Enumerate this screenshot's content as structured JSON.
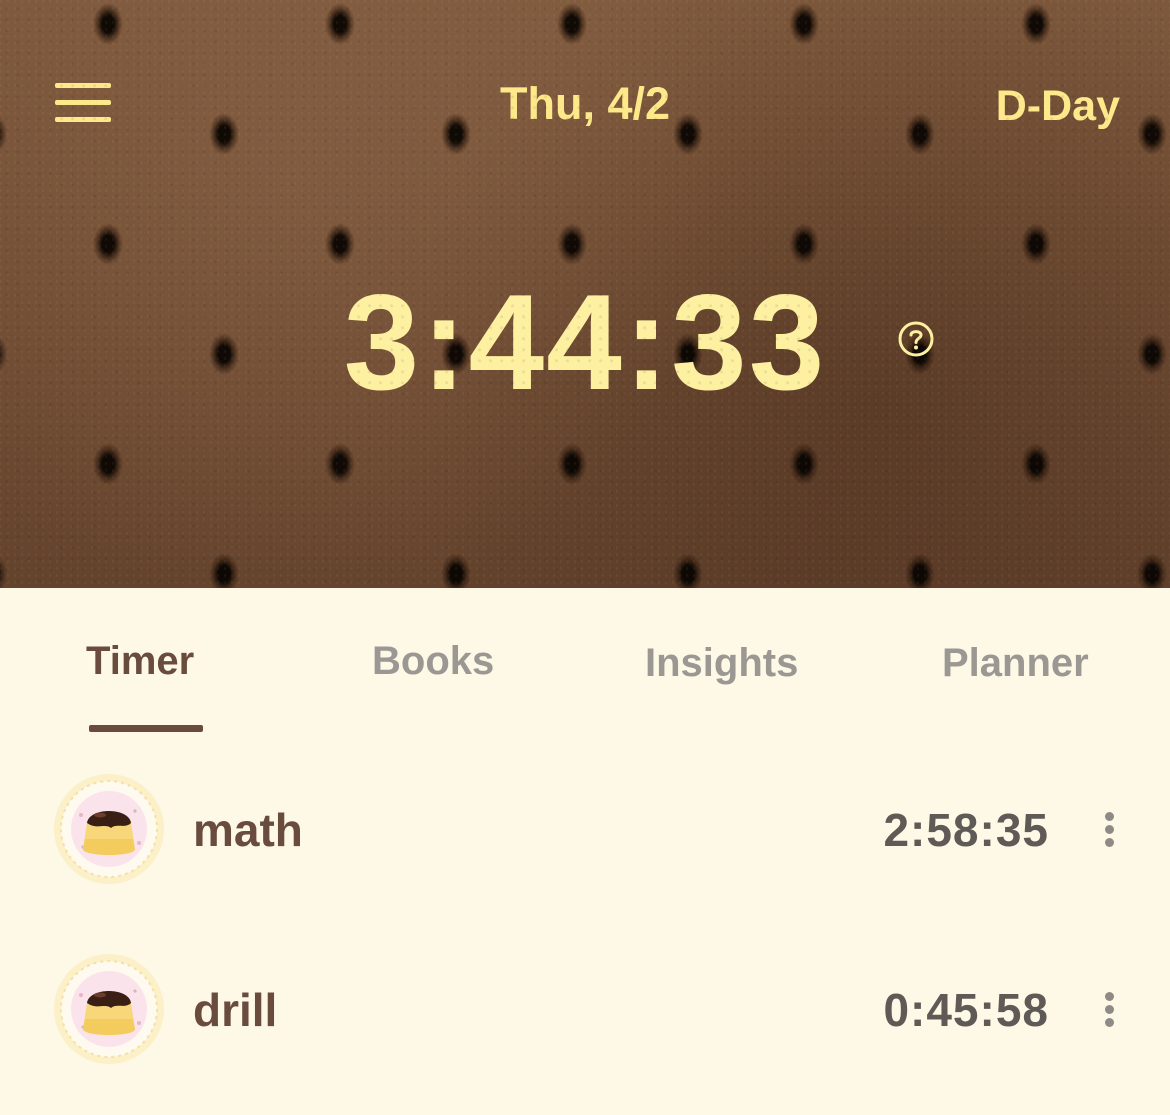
{
  "header": {
    "date": "Thu, 4/2",
    "dday_label": "D-Day",
    "total_time": "3:44:33",
    "icons": {
      "menu": "hamburger-menu-icon",
      "help": "question-circle-icon"
    }
  },
  "tabs": [
    {
      "label": "Timer",
      "active": true
    },
    {
      "label": "Books",
      "active": false
    },
    {
      "label": "Insights",
      "active": false
    },
    {
      "label": "Planner",
      "active": false
    }
  ],
  "subjects": [
    {
      "name": "math",
      "time": "2:58:35",
      "icon": "pudding-avatar-icon"
    },
    {
      "name": "drill",
      "time": "0:45:58",
      "icon": "pudding-avatar-icon"
    }
  ],
  "colors": {
    "accent_yellow": "#fde98a",
    "timer_yellow": "#fdf0a0",
    "brown_text": "#6a4c3e",
    "gray_tab": "#9b9893",
    "background": "#fdf9e6",
    "header_brown": "#7a553a"
  }
}
